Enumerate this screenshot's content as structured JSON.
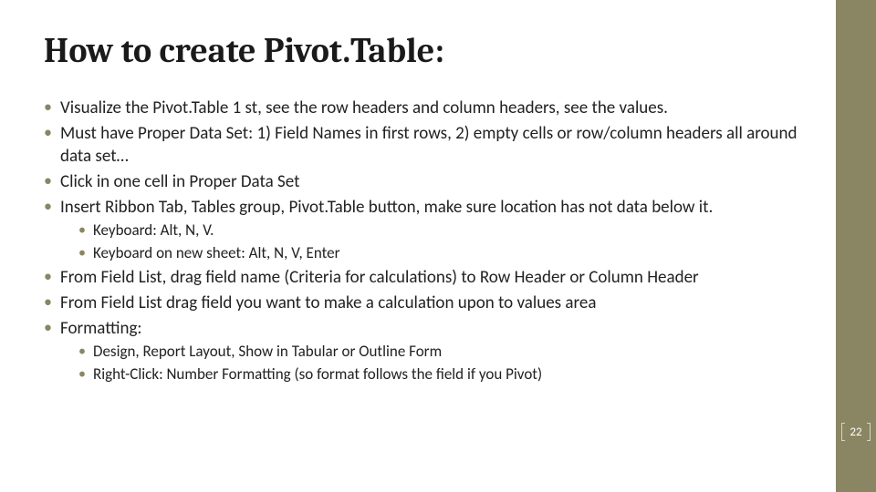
{
  "slide": {
    "title": "How to create Pivot.Table:",
    "bullets": [
      {
        "text": "Visualize the Pivot.Table 1 st, see the row headers and column headers, see the values."
      },
      {
        "text": "Must have Proper Data Set: 1) Field Names in first rows, 2) empty cells or row/column headers all around data set…"
      },
      {
        "text": "Click in one cell in Proper Data Set"
      },
      {
        "text": "Insert Ribbon Tab, Tables group, Pivot.Table button, make sure location has not data below it.",
        "sub": [
          "Keyboard: Alt, N, V.",
          "Keyboard on new sheet: Alt, N, V, Enter"
        ]
      },
      {
        "text": "From Field List, drag field name (Criteria for calculations) to Row Header or Column Header"
      },
      {
        "text": "From Field List drag field you want to make a calculation upon to values area"
      },
      {
        "text": "Formatting:",
        "sub": [
          "Design, Report Layout, Show in Tabular or Outline Form",
          "Right-Click: Number Formatting (so format follows the field if you Pivot)"
        ]
      }
    ],
    "page_number": "22"
  }
}
